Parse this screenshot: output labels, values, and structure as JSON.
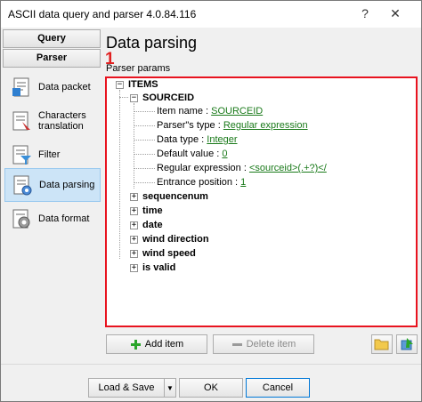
{
  "window": {
    "title": "ASCII data query and parser 4.0.84.116",
    "help_glyph": "?",
    "close_glyph": "✕"
  },
  "nav": {
    "buttons": [
      "Query",
      "Parser"
    ],
    "items": [
      {
        "label": "Data packet",
        "icon": "data-packet-icon"
      },
      {
        "label": "Characters translation",
        "icon": "characters-translation-icon"
      },
      {
        "label": "Filter",
        "icon": "filter-icon"
      },
      {
        "label": "Data parsing",
        "icon": "data-parsing-icon",
        "selected": true
      },
      {
        "label": "Data format",
        "icon": "data-format-icon"
      }
    ]
  },
  "page": {
    "title": "Data parsing",
    "params_label": "Parser params",
    "marker": "1"
  },
  "tree": {
    "root": "ITEMS",
    "item": "SOURCEID",
    "props": [
      {
        "label": "Item name : ",
        "value": "SOURCEID"
      },
      {
        "label": "Parser\"s type : ",
        "value": "Regular expression"
      },
      {
        "label": "Data type : ",
        "value": "Integer"
      },
      {
        "label": "Default value : ",
        "value": "0"
      },
      {
        "label": "Regular expression : ",
        "value": "<sourceid>(.+?)</"
      },
      {
        "label": "Entrance position : ",
        "value": "1"
      }
    ],
    "others": [
      "sequencenum",
      "time",
      "date",
      "wind direction",
      "wind speed",
      "is valid"
    ]
  },
  "actions": {
    "add": "Add item",
    "delete": "Delete item"
  },
  "footer": {
    "load_save": "Load & Save",
    "ok": "OK",
    "cancel": "Cancel"
  },
  "colors": {
    "marker": "#e8131f",
    "link": "#1a7a1a",
    "selected": "#cce4f7"
  }
}
